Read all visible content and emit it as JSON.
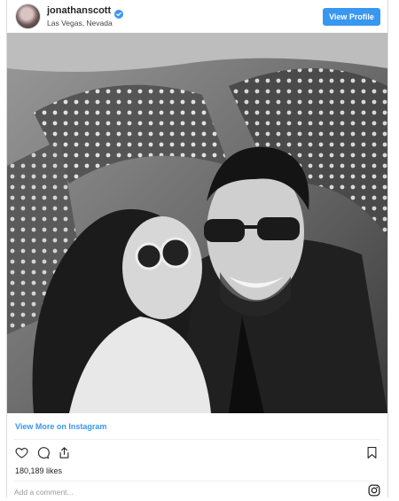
{
  "post": {
    "username": "jonathanscott",
    "location": "Las Vegas, Nevada",
    "view_profile_label": "View Profile",
    "view_more_label": "View More on Instagram",
    "likes_text": "180,189 likes",
    "comment_placeholder": "Add a comment..."
  },
  "colors": {
    "accent": "#3897f0",
    "verified": "#3897f0",
    "text": "#262626",
    "muted": "#999999"
  },
  "icons": {
    "verified": "verified-badge-icon",
    "like": "heart-icon",
    "comment": "comment-icon",
    "share": "share-icon",
    "save": "bookmark-icon",
    "brand": "instagram-icon"
  },
  "image": {
    "subject": "black-and-white selfie of a woman kissing a smiling man in sunglasses among neon marquee signs"
  }
}
